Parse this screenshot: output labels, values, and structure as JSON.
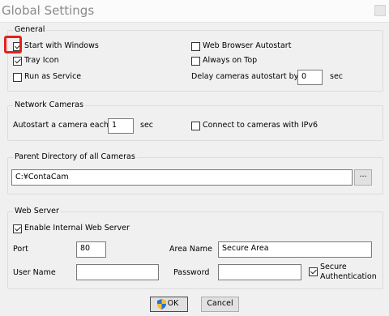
{
  "window": {
    "title": "Global Settings"
  },
  "general": {
    "label": "General",
    "start_with_windows": {
      "label": "Start with Windows",
      "checked": true
    },
    "tray_icon": {
      "label": "Tray Icon",
      "checked": true
    },
    "run_as_service": {
      "label": "Run as Service",
      "checked": false
    },
    "browser_autostart": {
      "label": "Web Browser Autostart",
      "checked": false
    },
    "always_on_top": {
      "label": "Always on Top",
      "checked": false
    },
    "delay_label": "Delay cameras autostart by",
    "delay_value": "0",
    "delay_unit": "sec"
  },
  "network": {
    "label": "Network Cameras",
    "autostart_label": "Autostart a camera each",
    "autostart_value": "1",
    "autostart_unit": "sec",
    "ipv6": {
      "label": "Connect to cameras with IPv6",
      "checked": false
    }
  },
  "parent_dir": {
    "label": "Parent Directory of all Cameras",
    "path": "C:¥ContaCam",
    "browse_label": "..."
  },
  "web_server": {
    "label": "Web Server",
    "enable": {
      "label": "Enable Internal Web Server",
      "checked": true
    },
    "port_label": "Port",
    "port_value": "80",
    "area_name_label": "Area Name",
    "area_name_value": "Secure Area",
    "user_name_label": "User Name",
    "user_name_value": "",
    "password_label": "Password",
    "password_value": "",
    "secure_auth": {
      "label_line1": "Secure",
      "label_line2": "Authentication",
      "checked": true
    }
  },
  "buttons": {
    "ok": "OK",
    "cancel": "Cancel"
  },
  "colors": {
    "highlight": "#e3211a",
    "shield_blue": "#2a6fd6",
    "shield_yellow": "#f2c12e"
  }
}
